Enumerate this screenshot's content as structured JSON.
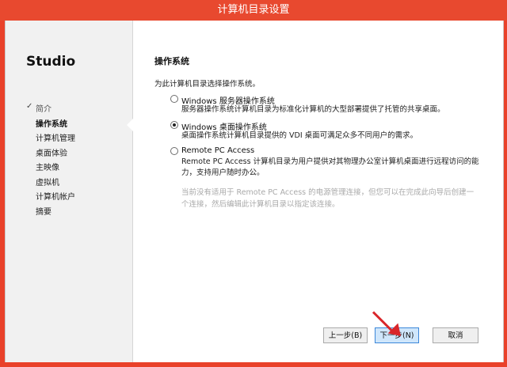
{
  "window": {
    "title": "计算机目录设置"
  },
  "sidebar": {
    "title": "Studio",
    "steps": [
      {
        "label": "简介",
        "state": "done",
        "check": "✓"
      },
      {
        "label": "操作系统",
        "state": "current"
      },
      {
        "label": "计算机管理"
      },
      {
        "label": "桌面体验"
      },
      {
        "label": "主映像"
      },
      {
        "label": "虚拟机"
      },
      {
        "label": "计算机帐户"
      },
      {
        "label": "摘要"
      }
    ]
  },
  "main": {
    "section_title": "操作系统",
    "prompt": "为此计算机目录选择操作系统。",
    "options": [
      {
        "label": "Windows 服务器操作系统",
        "description": "服务器操作系统计算机目录为标准化计算机的大型部署提供了托管的共享桌面。",
        "selected": false
      },
      {
        "label": "Windows 桌面操作系统",
        "description": "桌面操作系统计算机目录提供的 VDI 桌面可满足众多不同用户的需求。",
        "selected": true
      },
      {
        "label": "Remote PC Access",
        "description": "Remote PC Access 计算机目录为用户提供对其物理办公室计算机桌面进行远程访问的能力，支持用户随时办公。",
        "selected": false
      }
    ],
    "note": "当前没有适用于 Remote PC Access 的电源管理连接，但您可以在完成此向导后创建一个连接，然后编辑此计算机目录以指定该连接。"
  },
  "footer": {
    "back_label": "上一步(B)",
    "next_label": "下一步(N)",
    "cancel_label": "取消"
  },
  "colors": {
    "accent_border": "#e9412a",
    "primary_button": "#cfe6fb",
    "annotation_arrow": "#d9262a"
  }
}
